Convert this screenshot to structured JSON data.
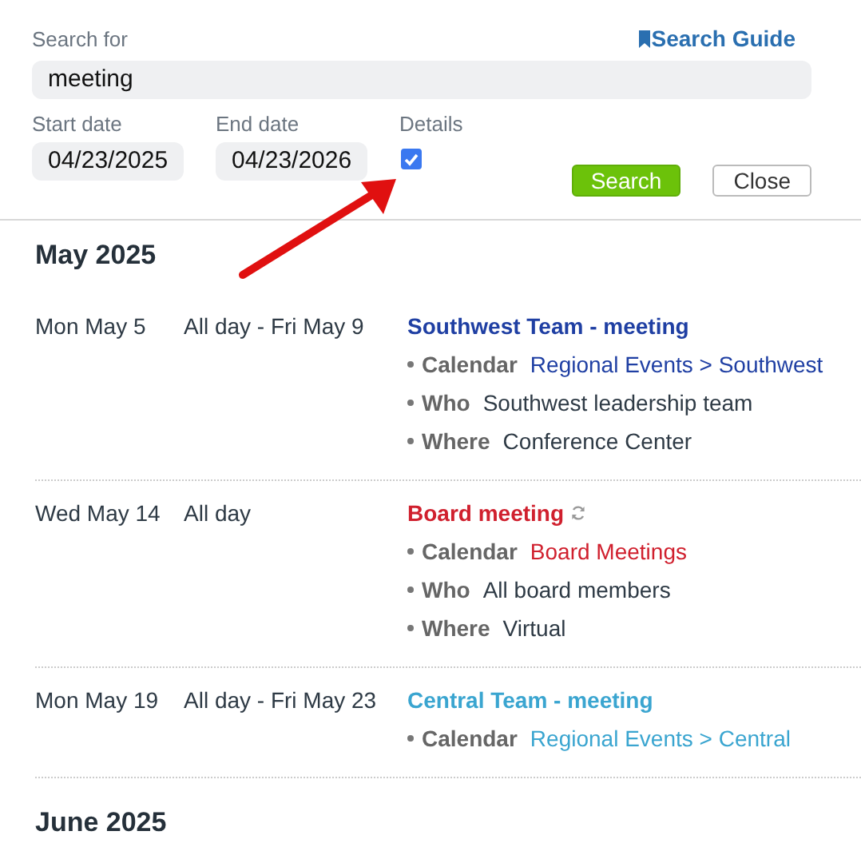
{
  "search": {
    "label": "Search for",
    "value": "meeting",
    "guide_link": "Search Guide"
  },
  "start_date": {
    "label": "Start date",
    "value": "04/23/2025"
  },
  "end_date": {
    "label": "End date",
    "value": "04/23/2026"
  },
  "details": {
    "label": "Details",
    "checked": true
  },
  "buttons": [
    {
      "kind": "primary",
      "label": "Search"
    },
    {
      "kind": "secondary",
      "label": "Close"
    }
  ],
  "months": [
    {
      "title": "May 2025",
      "events": [
        {
          "date": "Mon May 5",
          "time": "All day - Fri May 9",
          "title": "Southwest Team - meeting",
          "color": "#1f3fa3",
          "recurring": false,
          "details": [
            {
              "label": "Calendar",
              "value": "Regional Events > Southwest",
              "kind": "link"
            },
            {
              "label": "Who",
              "value": "Southwest leadership team",
              "kind": "text"
            },
            {
              "label": "Where",
              "value": "Conference Center",
              "kind": "text"
            }
          ]
        },
        {
          "date": "Wed May 14",
          "time": "All day",
          "title": "Board meeting",
          "color": "#d0202e",
          "recurring": true,
          "details": [
            {
              "label": "Calendar",
              "value": "Board Meetings",
              "kind": "link"
            },
            {
              "label": "Who",
              "value": "All board members",
              "kind": "text"
            },
            {
              "label": "Where",
              "value": "Virtual",
              "kind": "text"
            }
          ]
        },
        {
          "date": "Mon May 19",
          "time": "All day - Fri May 23",
          "title": "Central Team - meeting",
          "color": "#3aa5d0",
          "recurring": false,
          "details": [
            {
              "label": "Calendar",
              "value": "Regional Events > Central",
              "kind": "link"
            }
          ]
        }
      ]
    },
    {
      "title": "June 2025"
    }
  ]
}
